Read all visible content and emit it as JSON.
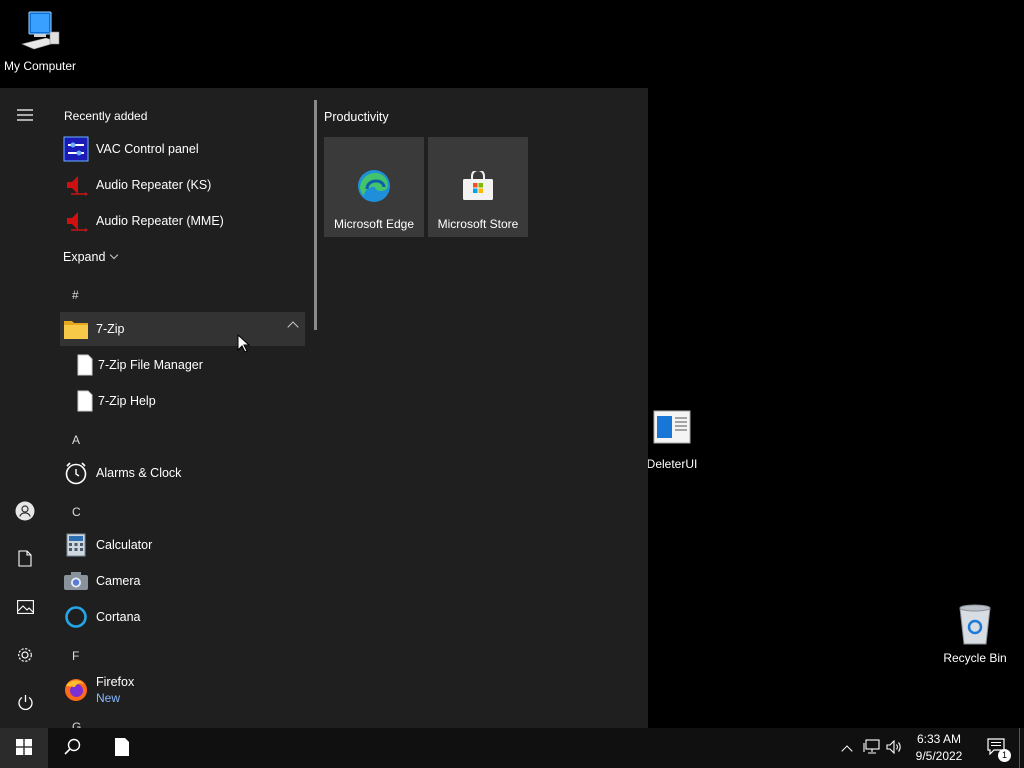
{
  "desktop": {
    "icons": [
      {
        "label": "My Computer",
        "icon": "computer-icon"
      },
      {
        "label": "DeleterUI",
        "icon": "app-window-icon"
      },
      {
        "label": "Recycle Bin",
        "icon": "recycle-bin-icon"
      }
    ]
  },
  "start_menu": {
    "recently_added_title": "Recently added",
    "recent": [
      {
        "label": "VAC Control panel",
        "icon": "vac-icon"
      },
      {
        "label": "Audio Repeater (KS)",
        "icon": "audio-repeater-icon"
      },
      {
        "label": "Audio Repeater (MME)",
        "icon": "audio-repeater-icon"
      }
    ],
    "expand_label": "Expand",
    "groups": {
      "hash": "#",
      "a": "A",
      "c": "C",
      "f": "F",
      "g": "G"
    },
    "seven_zip": {
      "label": "7-Zip",
      "children": [
        {
          "label": "7-Zip File Manager"
        },
        {
          "label": "7-Zip Help"
        }
      ]
    },
    "apps_a": [
      {
        "label": "Alarms & Clock",
        "icon": "alarm-clock-icon"
      }
    ],
    "apps_c": [
      {
        "label": "Calculator",
        "icon": "calculator-icon"
      },
      {
        "label": "Camera",
        "icon": "camera-icon"
      },
      {
        "label": "Cortana",
        "icon": "cortana-icon"
      }
    ],
    "apps_f": [
      {
        "label": "Firefox",
        "badge": "New",
        "icon": "firefox-icon"
      }
    ],
    "tiles_group_title": "Productivity",
    "tiles": [
      {
        "label": "Microsoft Edge",
        "icon": "edge-icon"
      },
      {
        "label": "Microsoft Store",
        "icon": "store-icon"
      }
    ]
  },
  "taskbar": {
    "time": "6:33 AM",
    "date": "9/5/2022",
    "notification_count": "1"
  },
  "colors": {
    "start_menu_bg": "#1f1f1f",
    "tile_bg": "#3a3a3a",
    "taskbar_bg": "#101010",
    "firefox_badge": "#86b8ff"
  }
}
